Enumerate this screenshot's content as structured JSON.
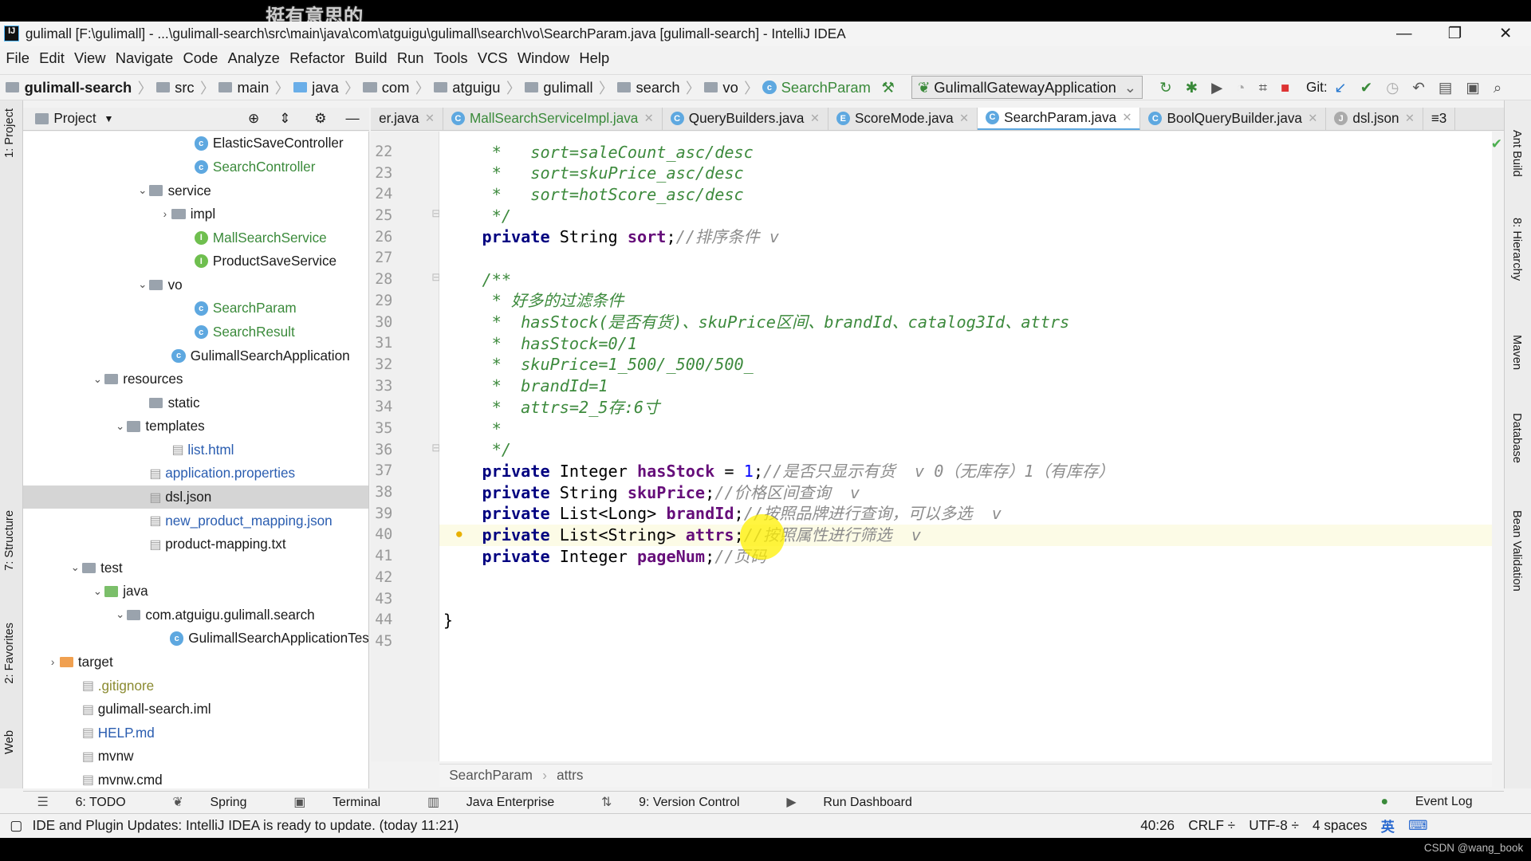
{
  "watermark": "挺有意思的",
  "window": {
    "title": "gulimall [F:\\gulimall] - ...\\gulimall-search\\src\\main\\java\\com\\atguigu\\gulimall\\search\\vo\\SearchParam.java [gulimall-search] - IntelliJ IDEA",
    "app_icon": "IJ",
    "min": "—",
    "max": "❐",
    "close": "✕"
  },
  "menu": [
    "File",
    "Edit",
    "View",
    "Navigate",
    "Code",
    "Analyze",
    "Refactor",
    "Build",
    "Run",
    "Tools",
    "VCS",
    "Window",
    "Help"
  ],
  "nav": {
    "crumbs": [
      {
        "label": "gulimall-search",
        "icon": "module"
      },
      {
        "label": "src",
        "icon": "folder"
      },
      {
        "label": "main",
        "icon": "folder"
      },
      {
        "label": "java",
        "icon": "folder-blue"
      },
      {
        "label": "com",
        "icon": "folder"
      },
      {
        "label": "atguigu",
        "icon": "folder"
      },
      {
        "label": "gulimall",
        "icon": "folder"
      },
      {
        "label": "search",
        "icon": "folder"
      },
      {
        "label": "vo",
        "icon": "folder"
      },
      {
        "label": "SearchParam",
        "icon": "class"
      }
    ],
    "run_config": "GulimallGatewayApplication",
    "git_label": "Git:"
  },
  "project": {
    "title": "Project",
    "items": [
      {
        "label": "ElasticSaveController",
        "icon": "class",
        "indent": 7,
        "color": "#1a1a1a"
      },
      {
        "label": "SearchController",
        "icon": "class",
        "indent": 7,
        "color": "#3a8a3a"
      },
      {
        "label": "service",
        "icon": "folder",
        "indent": 5,
        "arrow": "⌄",
        "color": "#1a1a1a"
      },
      {
        "label": "impl",
        "icon": "folder",
        "indent": 6,
        "arrow": "›",
        "color": "#1a1a1a"
      },
      {
        "label": "MallSearchService",
        "icon": "interface",
        "indent": 7,
        "color": "#3a8a3a"
      },
      {
        "label": "ProductSaveService",
        "icon": "interface",
        "indent": 7,
        "color": "#1a1a1a"
      },
      {
        "label": "vo",
        "icon": "folder",
        "indent": 5,
        "arrow": "⌄",
        "color": "#1a1a1a"
      },
      {
        "label": "SearchParam",
        "icon": "class",
        "indent": 7,
        "color": "#3a8a3a"
      },
      {
        "label": "SearchResult",
        "icon": "class",
        "indent": 7,
        "color": "#3a8a3a"
      },
      {
        "label": "GulimallSearchApplication",
        "icon": "class",
        "indent": 6,
        "color": "#1a1a1a"
      },
      {
        "label": "resources",
        "icon": "folder",
        "indent": 3,
        "arrow": "⌄",
        "color": "#1a1a1a"
      },
      {
        "label": "static",
        "icon": "folder",
        "indent": 5,
        "color": "#1a1a1a"
      },
      {
        "label": "templates",
        "icon": "folder",
        "indent": 4,
        "arrow": "⌄",
        "color": "#1a1a1a"
      },
      {
        "label": "list.html",
        "icon": "file",
        "indent": 6,
        "color": "#2a5db0"
      },
      {
        "label": "application.properties",
        "icon": "file",
        "indent": 5,
        "color": "#2a5db0"
      },
      {
        "label": "dsl.json",
        "icon": "file",
        "indent": 5,
        "color": "#1a1a1a",
        "selected": true
      },
      {
        "label": "new_product_mapping.json",
        "icon": "file",
        "indent": 5,
        "color": "#2a5db0"
      },
      {
        "label": "product-mapping.txt",
        "icon": "file",
        "indent": 5,
        "color": "#1a1a1a"
      },
      {
        "label": "test",
        "icon": "folder",
        "indent": 2,
        "arrow": "⌄",
        "color": "#1a1a1a"
      },
      {
        "label": "java",
        "icon": "folder-green",
        "indent": 3,
        "arrow": "⌄",
        "color": "#1a1a1a"
      },
      {
        "label": "com.atguigu.gulimall.search",
        "icon": "folder",
        "indent": 4,
        "arrow": "⌄",
        "color": "#1a1a1a"
      },
      {
        "label": "GulimallSearchApplicationTes",
        "icon": "class",
        "indent": 6,
        "color": "#1a1a1a"
      },
      {
        "label": "target",
        "icon": "folder-orange",
        "indent": 1,
        "arrow": "›",
        "color": "#1a1a1a"
      },
      {
        "label": ".gitignore",
        "icon": "file",
        "indent": 2,
        "color": "#8a8a30"
      },
      {
        "label": "gulimall-search.iml",
        "icon": "file",
        "indent": 2,
        "color": "#1a1a1a"
      },
      {
        "label": "HELP.md",
        "icon": "file",
        "indent": 2,
        "color": "#2a5db0"
      },
      {
        "label": "mvnw",
        "icon": "file",
        "indent": 2,
        "color": "#1a1a1a"
      },
      {
        "label": "mvnw.cmd",
        "icon": "file",
        "indent": 2,
        "color": "#1a1a1a"
      }
    ]
  },
  "tabs": [
    {
      "label": "er.java",
      "color": "#1a1a1a"
    },
    {
      "label": "MallSearchServiceImpl.java",
      "icon": "C",
      "color": "#3a8a3a"
    },
    {
      "label": "QueryBuilders.java",
      "icon": "C",
      "color": "#1a1a1a"
    },
    {
      "label": "ScoreMode.java",
      "icon": "E",
      "color": "#1a1a1a"
    },
    {
      "label": "SearchParam.java",
      "icon": "C",
      "color": "#1a1a1a",
      "active": true
    },
    {
      "label": "BoolQueryBuilder.java",
      "icon": "C",
      "color": "#1a1a1a"
    },
    {
      "label": "dsl.json",
      "icon": "J",
      "color": "#1a1a1a"
    }
  ],
  "tabs_overflow": "≡3",
  "code": {
    "first_line": 22,
    "current_line": 40,
    "lines": [
      [
        [
          "dc",
          "     *   sort=saleCount_asc/desc"
        ]
      ],
      [
        [
          "dc",
          "     *   sort=skuPrice_asc/desc"
        ]
      ],
      [
        [
          "dc",
          "     *   sort=hotScore_asc/desc"
        ]
      ],
      [
        [
          "dc",
          "     */"
        ]
      ],
      [
        [
          "pl",
          "    "
        ],
        [
          "kw",
          "private "
        ],
        [
          "pl",
          "String "
        ],
        [
          "fd",
          "sort"
        ],
        [
          "pl",
          ";"
        ],
        [
          "cm",
          "//排序条件 v"
        ]
      ],
      [],
      [
        [
          "dc",
          "    /**"
        ]
      ],
      [
        [
          "dc",
          "     * 好多的过滤条件"
        ]
      ],
      [
        [
          "dc",
          "     *  hasStock(是否有货)、skuPrice区间、brandId、catalog3Id、attrs"
        ]
      ],
      [
        [
          "dc",
          "     *  hasStock=0/1"
        ]
      ],
      [
        [
          "dc",
          "     *  skuPrice=1_500/_500/500_"
        ]
      ],
      [
        [
          "dc",
          "     *  brandId=1"
        ]
      ],
      [
        [
          "dc",
          "     *  attrs=2_5存:6寸"
        ]
      ],
      [
        [
          "dc",
          "     *"
        ]
      ],
      [
        [
          "dc",
          "     */"
        ]
      ],
      [
        [
          "pl",
          "    "
        ],
        [
          "kw",
          "private "
        ],
        [
          "pl",
          "Integer "
        ],
        [
          "fd",
          "hasStock"
        ],
        [
          "pl",
          " = "
        ],
        [
          "nm",
          "1"
        ],
        [
          "pl",
          ";"
        ],
        [
          "cm",
          "//是否只显示有货  v 0（无库存）1（有库存）"
        ]
      ],
      [
        [
          "pl",
          "    "
        ],
        [
          "kw",
          "private "
        ],
        [
          "pl",
          "String "
        ],
        [
          "fd",
          "skuPrice"
        ],
        [
          "pl",
          ";"
        ],
        [
          "cm",
          "//价格区间查询  v"
        ]
      ],
      [
        [
          "pl",
          "    "
        ],
        [
          "kw",
          "private "
        ],
        [
          "pl",
          "List<Long> "
        ],
        [
          "fd",
          "brandId"
        ],
        [
          "pl",
          ";"
        ],
        [
          "cm",
          "//按照品牌进行查询，可以多选  v"
        ]
      ],
      [
        [
          "pl",
          "    "
        ],
        [
          "kw",
          "private "
        ],
        [
          "pl",
          "List<String> "
        ],
        [
          "fd",
          "attrs"
        ],
        [
          "pl",
          ";"
        ],
        [
          "cm",
          "//按照属性进行筛选  v"
        ]
      ],
      [
        [
          "pl",
          "    "
        ],
        [
          "kw",
          "private "
        ],
        [
          "pl",
          "Integer "
        ],
        [
          "fd",
          "pageNum"
        ],
        [
          "pl",
          ";"
        ],
        [
          "cm",
          "//页码"
        ]
      ],
      [],
      [],
      [
        [
          "pl",
          "}"
        ]
      ],
      []
    ]
  },
  "breadcrumb": [
    "SearchParam",
    "attrs"
  ],
  "toolwindows": [
    "6: TODO",
    "Spring",
    "Terminal",
    "Java Enterprise",
    "9: Version Control",
    "Run Dashboard"
  ],
  "event_log": "Event Log",
  "left_tabs": [
    "1: Project",
    "7: Structure",
    "2: Favorites",
    "Web"
  ],
  "right_tabs": [
    "Ant Build",
    "8: Hierarchy",
    "Maven",
    "Database",
    "Bean Validation"
  ],
  "status": {
    "message": "IDE and Plugin Updates: IntelliJ IDEA is ready to update. (today 11:21)",
    "position": "40:26",
    "line_sep": "CRLF ÷",
    "encoding": "UTF-8 ÷",
    "indent": "4 spaces",
    "ime": "英"
  },
  "footer": "CSDN @wang_book"
}
